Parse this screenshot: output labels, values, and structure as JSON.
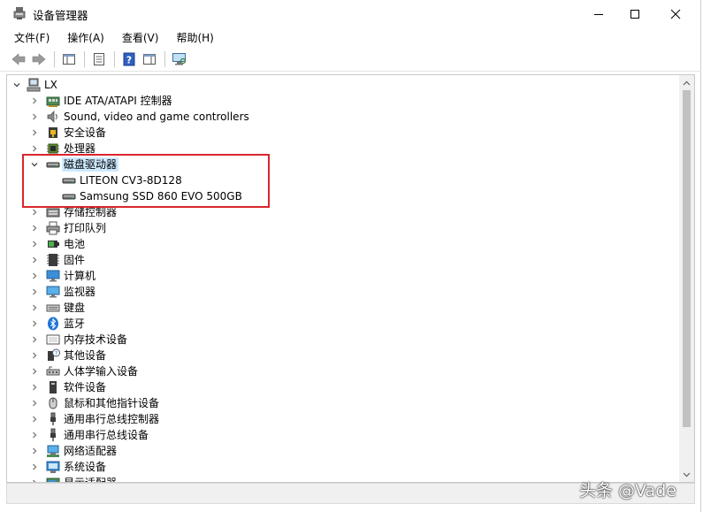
{
  "window": {
    "title": "设备管理器",
    "controls": {
      "minimize": "minimize-icon",
      "maximize": "maximize-icon",
      "close": "close-icon"
    }
  },
  "menu": [
    "文件(F)",
    "操作(A)",
    "查看(V)",
    "帮助(H)"
  ],
  "toolbar": {
    "buttons": [
      "back-arrow-icon",
      "forward-arrow-icon",
      "show-hide-console-tree-icon",
      "properties-icon",
      "help-icon",
      "action-pane-icon",
      "scan-hardware-icon"
    ]
  },
  "tree": {
    "root": "LX",
    "items": [
      {
        "label": "IDE ATA/ATAPI 控制器",
        "icon": "ide-controller-icon",
        "expanded": false
      },
      {
        "label": "Sound, video and game controllers",
        "icon": "speaker-icon",
        "expanded": false
      },
      {
        "label": "安全设备",
        "icon": "security-device-icon",
        "expanded": false
      },
      {
        "label": "处理器",
        "icon": "processor-icon",
        "expanded": false
      },
      {
        "label": "磁盘驱动器",
        "icon": "disk-drive-icon",
        "expanded": true,
        "selected": true,
        "children": [
          {
            "label": "LITEON CV3-8D128",
            "icon": "disk-drive-icon"
          },
          {
            "label": "Samsung SSD 860 EVO 500GB",
            "icon": "disk-drive-icon"
          }
        ]
      },
      {
        "label": "存储控制器",
        "icon": "storage-controller-icon",
        "expanded": false
      },
      {
        "label": "打印队列",
        "icon": "printer-icon",
        "expanded": false
      },
      {
        "label": "电池",
        "icon": "battery-icon",
        "expanded": false
      },
      {
        "label": "固件",
        "icon": "firmware-icon",
        "expanded": false
      },
      {
        "label": "计算机",
        "icon": "computer-icon",
        "expanded": false
      },
      {
        "label": "监视器",
        "icon": "monitor-icon",
        "expanded": false
      },
      {
        "label": "键盘",
        "icon": "keyboard-icon",
        "expanded": false
      },
      {
        "label": "蓝牙",
        "icon": "bluetooth-icon",
        "expanded": false
      },
      {
        "label": "内存技术设备",
        "icon": "memory-device-icon",
        "expanded": false
      },
      {
        "label": "其他设备",
        "icon": "unknown-device-icon",
        "expanded": false
      },
      {
        "label": "人体学输入设备",
        "icon": "hid-icon",
        "expanded": false
      },
      {
        "label": "软件设备",
        "icon": "software-device-icon",
        "expanded": false
      },
      {
        "label": "鼠标和其他指针设备",
        "icon": "mouse-icon",
        "expanded": false
      },
      {
        "label": "通用串行总线控制器",
        "icon": "usb-icon",
        "expanded": false
      },
      {
        "label": "通用串行总线设备",
        "icon": "usb-icon",
        "expanded": false
      },
      {
        "label": "网络适配器",
        "icon": "network-adapter-icon",
        "expanded": false
      },
      {
        "label": "系统设备",
        "icon": "system-device-icon",
        "expanded": false
      },
      {
        "label": "显示适配器",
        "icon": "display-adapter-icon",
        "expanded": false
      }
    ]
  },
  "watermark": "头条 @Vade",
  "colors": {
    "highlight": "#d9262c",
    "selection": "#cce8ff",
    "scrollbar_thumb": "#c1c1c1"
  }
}
